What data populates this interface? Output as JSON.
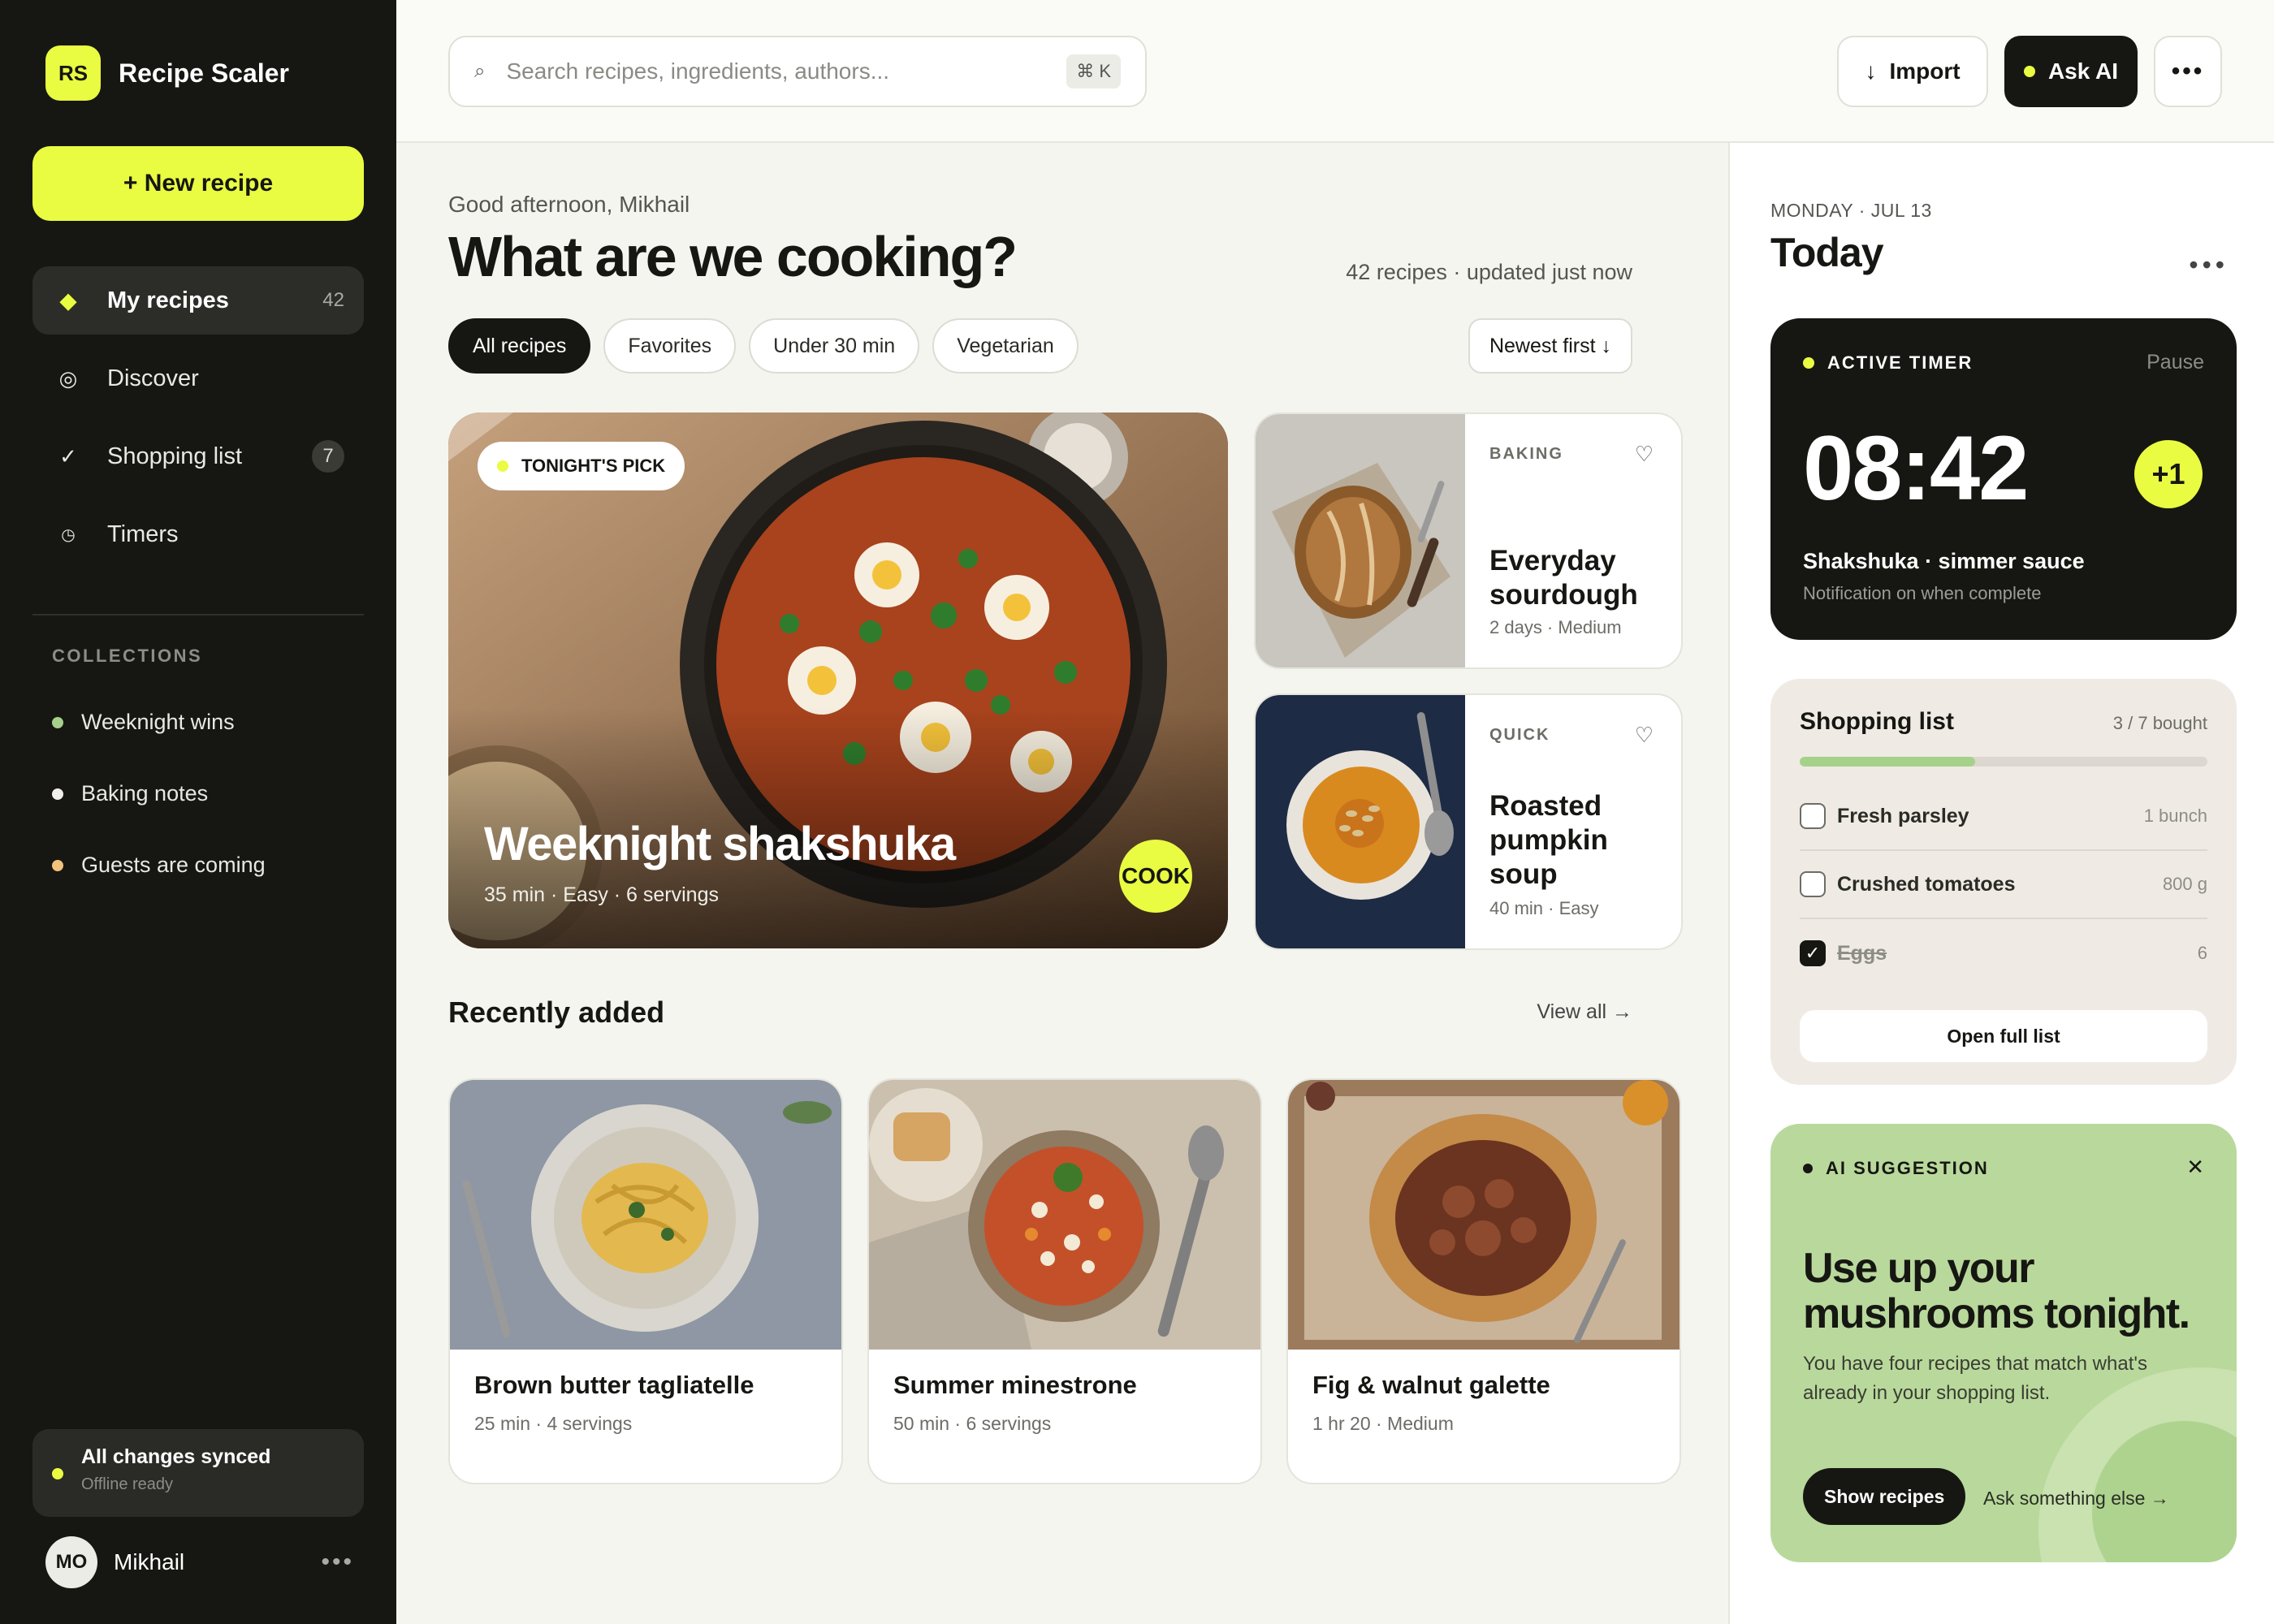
{
  "brand": {
    "badge": "RS",
    "name": "Recipe Scaler"
  },
  "new_recipe_label": "+ New recipe",
  "nav": [
    {
      "label": "My recipes",
      "icon": "diamond-icon",
      "count": "42"
    },
    {
      "label": "Discover",
      "icon": "compass-icon"
    },
    {
      "label": "Shopping list",
      "icon": "check-icon",
      "count": "7"
    },
    {
      "label": "Timers",
      "icon": "clock-icon"
    }
  ],
  "collections": {
    "heading": "COLLECTIONS",
    "items": [
      {
        "label": "Weeknight wins",
        "color": "#a6d18b"
      },
      {
        "label": "Baking notes",
        "color": "#f0efe9"
      },
      {
        "label": "Guests are coming",
        "color": "#f2c27a"
      }
    ]
  },
  "sync": {
    "title": "All changes synced",
    "subtitle": "Offline ready",
    "color": "#e9fc41"
  },
  "user": {
    "initials": "MO",
    "name": "Mikhail"
  },
  "topbar": {
    "search_placeholder": "Search recipes, ingredients, authors...",
    "shortcut": "⌘ K",
    "import_label": "Import",
    "ask_label": "Ask AI"
  },
  "main": {
    "greeting": "Good afternoon, Mikhail",
    "headline": "What are we cooking?",
    "meta": "42 recipes · updated just now",
    "filters": [
      "All recipes",
      "Favorites",
      "Under 30 min",
      "Vegetarian"
    ],
    "sort_label": "Newest first ↓",
    "hero": {
      "badge": "TONIGHT'S PICK",
      "title": "Weeknight shakshuka",
      "subtitle": "35 min · Easy · 6 servings",
      "cta": "COOK"
    },
    "side_cards": [
      {
        "tag": "BAKING",
        "title": "Everyday sourdough",
        "subtitle": "2 days · Medium"
      },
      {
        "tag": "QUICK",
        "title": "Roasted pumpkin soup",
        "subtitle": "40 min · Easy"
      }
    ],
    "recent_heading": "Recently added",
    "view_all": "View all →",
    "recent": [
      {
        "title": "Brown butter tagliatelle",
        "subtitle": "25 min · 4 servings"
      },
      {
        "title": "Summer minestrone",
        "subtitle": "50 min · 6 servings"
      },
      {
        "title": "Fig & walnut galette",
        "subtitle": "1 hr 20 · Medium"
      }
    ]
  },
  "panel": {
    "day": "MONDAY · JUL 13",
    "title": "Today",
    "timer": {
      "label": "ACTIVE TIMER",
      "pause": "Pause",
      "time": "08:42",
      "plus": "+1",
      "name": "Shakshuka · simmer sauce",
      "note": "Notification on when complete"
    },
    "shopping": {
      "title": "Shopping list",
      "count": "3 / 7 bought",
      "progress": 0.43,
      "items": [
        {
          "name": "Fresh parsley",
          "qty": "1 bunch",
          "checked": false
        },
        {
          "name": "Crushed tomatoes",
          "qty": "800 g",
          "checked": false
        },
        {
          "name": "Eggs",
          "qty": "6",
          "checked": true
        }
      ],
      "open_label": "Open full list"
    },
    "ai": {
      "label": "AI SUGGESTION",
      "title": "Use up your mushrooms tonight.",
      "body": "You have four recipes that match what's already in your shopping list.",
      "show_label": "Show recipes",
      "else_label": "Ask something else →"
    }
  },
  "accent_color": "#e9fc41"
}
